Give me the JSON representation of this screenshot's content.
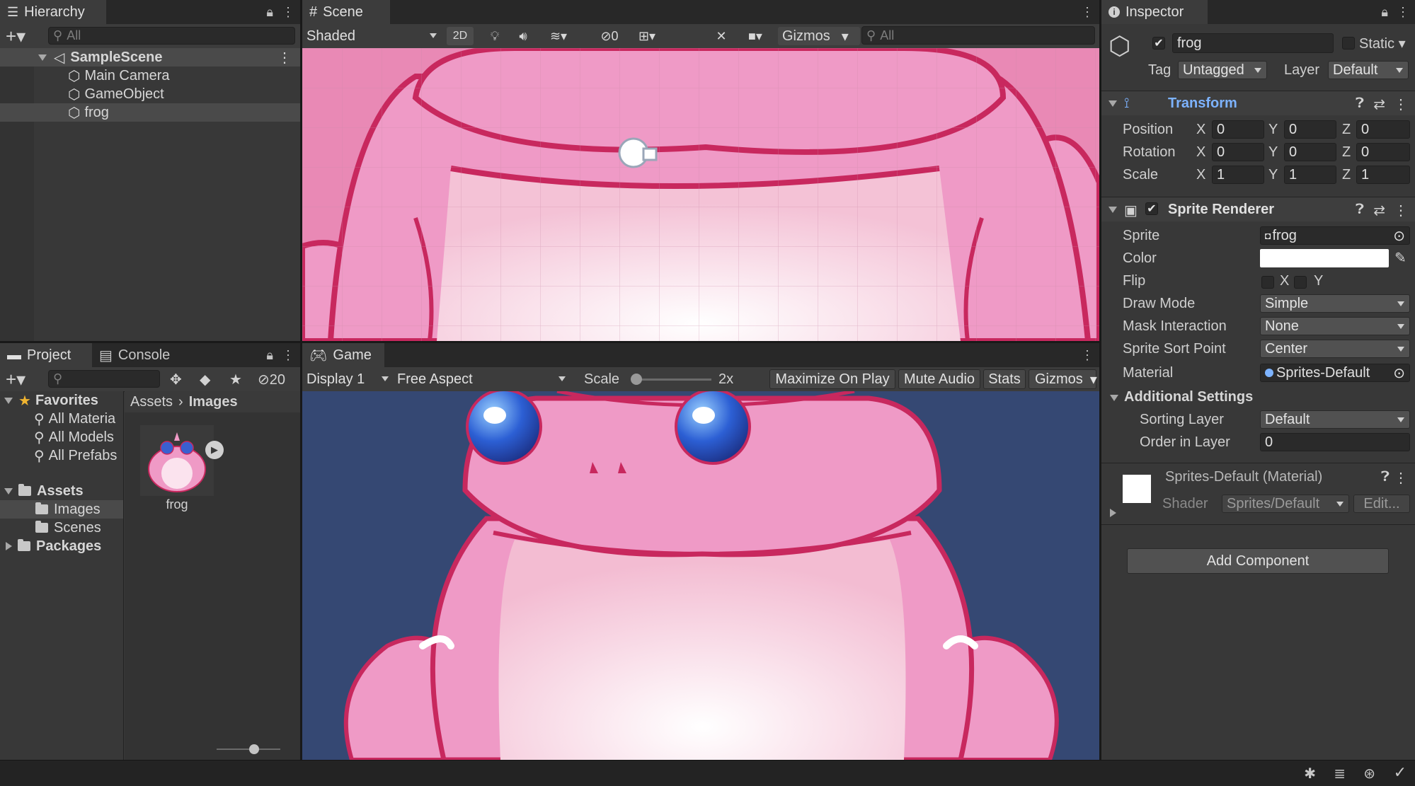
{
  "hierarchy": {
    "tab": "Hierarchy",
    "search_placeholder": "All",
    "scene_name": "SampleScene",
    "items": [
      "Main Camera",
      "GameObject",
      "frog"
    ]
  },
  "scene": {
    "tab": "Scene",
    "shading": "Shaded",
    "mode_2d": "2D",
    "hidden_count": "0",
    "gizmos": "Gizmos",
    "search_placeholder": "All"
  },
  "project": {
    "tab_project": "Project",
    "tab_console": "Console",
    "hidden_count": "20",
    "favorites_label": "Favorites",
    "favorites": [
      "All Materia",
      "All Models",
      "All Prefabs"
    ],
    "assets_label": "Assets",
    "asset_folders": [
      "Images",
      "Scenes"
    ],
    "packages_label": "Packages",
    "breadcrumb": [
      "Assets",
      "Images"
    ],
    "asset_item": "frog"
  },
  "game": {
    "tab": "Game",
    "display": "Display 1",
    "aspect": "Free Aspect",
    "scale_label": "Scale",
    "scale_value": "2x",
    "maximize": "Maximize On Play",
    "mute": "Mute Audio",
    "stats": "Stats",
    "gizmos": "Gizmos",
    "background_color": "#354873"
  },
  "inspector": {
    "tab": "Inspector",
    "object_name": "frog",
    "static_label": "Static",
    "tag_label": "Tag",
    "tag_value": "Untagged",
    "layer_label": "Layer",
    "layer_value": "Default",
    "transform": {
      "title": "Transform",
      "rows": [
        {
          "label": "Position",
          "x": "0",
          "y": "0",
          "z": "0"
        },
        {
          "label": "Rotation",
          "x": "0",
          "y": "0",
          "z": "0"
        },
        {
          "label": "Scale",
          "x": "1",
          "y": "1",
          "z": "1"
        }
      ],
      "axis_x": "X",
      "axis_y": "Y",
      "axis_z": "Z"
    },
    "sprite_renderer": {
      "title": "Sprite Renderer",
      "sprite_label": "Sprite",
      "sprite_value": "frog",
      "color_label": "Color",
      "flip_label": "Flip",
      "flip_x": "X",
      "flip_y": "Y",
      "draw_mode_label": "Draw Mode",
      "draw_mode_value": "Simple",
      "mask_label": "Mask Interaction",
      "mask_value": "None",
      "sort_point_label": "Sprite Sort Point",
      "sort_point_value": "Center",
      "material_label": "Material",
      "material_value": "Sprites-Default",
      "additional_label": "Additional Settings",
      "sorting_layer_label": "Sorting Layer",
      "sorting_layer_value": "Default",
      "order_label": "Order in Layer",
      "order_value": "0"
    },
    "material": {
      "title": "Sprites-Default (Material)",
      "shader_label": "Shader",
      "shader_value": "Sprites/Default",
      "edit_label": "Edit..."
    },
    "add_component": "Add Component"
  },
  "colors": {
    "frog_pink": "#ef9ac6",
    "frog_outline": "#c8285e",
    "frog_belly": "#f8d6e4",
    "accent_blue": "#7db3ff"
  }
}
